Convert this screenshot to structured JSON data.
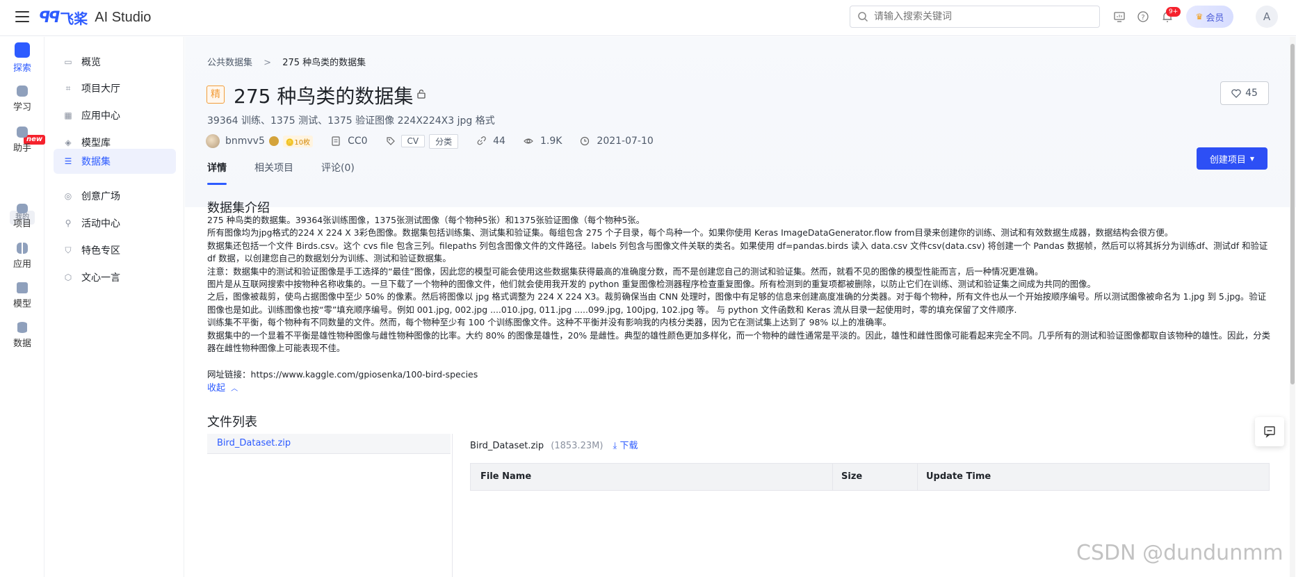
{
  "topbar": {
    "logo_mark": "ꟼꟼ",
    "logo_cn": "飞桨",
    "logo_en": "AI Studio",
    "search_placeholder": "请输入搜索关键词",
    "notification_count": "9+",
    "vip_label": "会员",
    "avatar_letter": "A"
  },
  "rail": {
    "items": [
      {
        "label": "探索",
        "icon": "compass-icon"
      },
      {
        "label": "学习",
        "icon": "book-icon"
      },
      {
        "label": "助手",
        "icon": "assistant-icon"
      },
      {
        "label": "项目",
        "icon": "code-folder-icon"
      },
      {
        "label": "应用",
        "icon": "apps-icon"
      },
      {
        "label": "模型",
        "icon": "cube-icon"
      },
      {
        "label": "数据",
        "icon": "database-icon"
      }
    ],
    "new_badge": "new",
    "mine_label": "我的"
  },
  "sidebar": {
    "items": [
      {
        "label": "概览"
      },
      {
        "label": "项目大厅"
      },
      {
        "label": "应用中心"
      },
      {
        "label": "模型库"
      },
      {
        "label": "数据集"
      },
      {
        "label": "创意广场"
      },
      {
        "label": "活动中心"
      },
      {
        "label": "特色专区"
      },
      {
        "label": "文心一言"
      }
    ]
  },
  "breadcrumb": {
    "parent": "公共数据集",
    "separator": ">",
    "current": "275 种鸟类的数据集"
  },
  "dataset": {
    "badge": "精",
    "title": "275 种鸟类的数据集",
    "subtitle": "39364 训练、1375 测试、1375 验证图像 224X224X3 jpg 格式",
    "author": "bnmvv5",
    "coins": "🪙10枚",
    "license": "CC0",
    "tags": [
      "CV",
      "分类"
    ],
    "forks": "44",
    "views": "1.9K",
    "date": "2021-07-10",
    "likes": "45"
  },
  "tabs": [
    {
      "label": "详情"
    },
    {
      "label": "相关项目"
    },
    {
      "label": "评论(0)"
    }
  ],
  "create_button": "创建项目",
  "intro": {
    "heading": "数据集介绍",
    "lines": [
      "275 种鸟类的数据集。39364张训练图像，1375张测试图像（每个物种5张）和1375张验证图像（每个物种5张。",
      "所有图像均为jpg格式的224 X 224 X 3彩色图像。数据集包括训练集、测试集和验证集。每组包含 275 个子目录，每个鸟种一个。如果你使用 Keras ImageDataGenerator.flow from目录来创建你的训练、测试和有效数据生成器，数据结构会很方便。",
      "数据集还包括一个文件 Birds.csv。这个 cvs file 包含三列。filepaths 列包含图像文件的文件路径。labels 列包含与图像文件关联的类名。如果使用 df=pandas.birds 读入 data.csv 文件csv(data.csv) 将创建一个 Pandas 数据帧，然后可以将其拆分为训练df、测试df 和验证df 数据，以创建您自己的数据划分为训练、测试和验证数据集。",
      "注意：数据集中的测试和验证图像是手工选择的“最佳”图像，因此您的模型可能会使用这些数据集获得最高的准确度分数，而不是创建您自己的测试和验证集。然而，就看不见的图像的模型性能而言，后一种情况更准确。",
      "图片是从互联网搜索中按物种名称收集的。一旦下载了一个物种的图像文件，他们就会使用我开发的 python 重复图像检测器程序检查重复图像。所有检测到的重复项都被删除，以防止它们在训练、测试和验证集之间成为共同的图像。",
      "之后，图像被裁剪，使鸟占据图像中至少 50% 的像素。然后将图像以 jpg 格式调整为 224 X 224 X3。裁剪确保当由 CNN 处理时，图像中有足够的信息来创建高度准确的分类器。对于每个物种，所有文件也从一个开始按顺序编号。所以测试图像被命名为 1.jpg 到 5.jpg。验证图像也是如此。训练图像也按“零”填充顺序编号。例如 001.jpg, 002.jpg ....010.jpg, 011.jpg .....099.jpg, 100jpg, 102.jpg 等。 与 python 文件函数和 Keras 流从目录一起使用时，零的填充保留了文件顺序.",
      "训练集不平衡，每个物种有不同数量的文件。然而，每个物种至少有 100 个训练图像文件。这种不平衡并没有影响我的内核分类器，因为它在测试集上达到了 98% 以上的准确率。",
      "数据集中的一个显着不平衡是雄性物种图像与雌性物种图像的比率。大约 80% 的图像是雄性，20% 是雌性。典型的雄性颜色更加多样化，而一个物种的雌性通常是平淡的。因此，雄性和雌性图像可能看起来完全不同。几乎所有的测试和验证图像都取自该物种的雄性。因此，分类器在雌性物种图像上可能表现不佳。"
    ],
    "link_label": "网址链接：",
    "link_url": "https://www.kaggle.com/gpiosenka/100-bird-species",
    "collapse": "收起"
  },
  "files": {
    "heading": "文件列表",
    "items": [
      {
        "name": "Bird_Dataset.zip"
      }
    ],
    "selected_name": "Bird_Dataset.zip",
    "selected_size": "(1853.23M)",
    "download": "下载",
    "columns": [
      "File Name",
      "Size",
      "Update Time"
    ]
  },
  "watermark": "CSDN @dundunmm",
  "colors": {
    "accent": "#2d5bff",
    "badge_orange": "#f29c38",
    "notify_red": "#f5222d"
  }
}
